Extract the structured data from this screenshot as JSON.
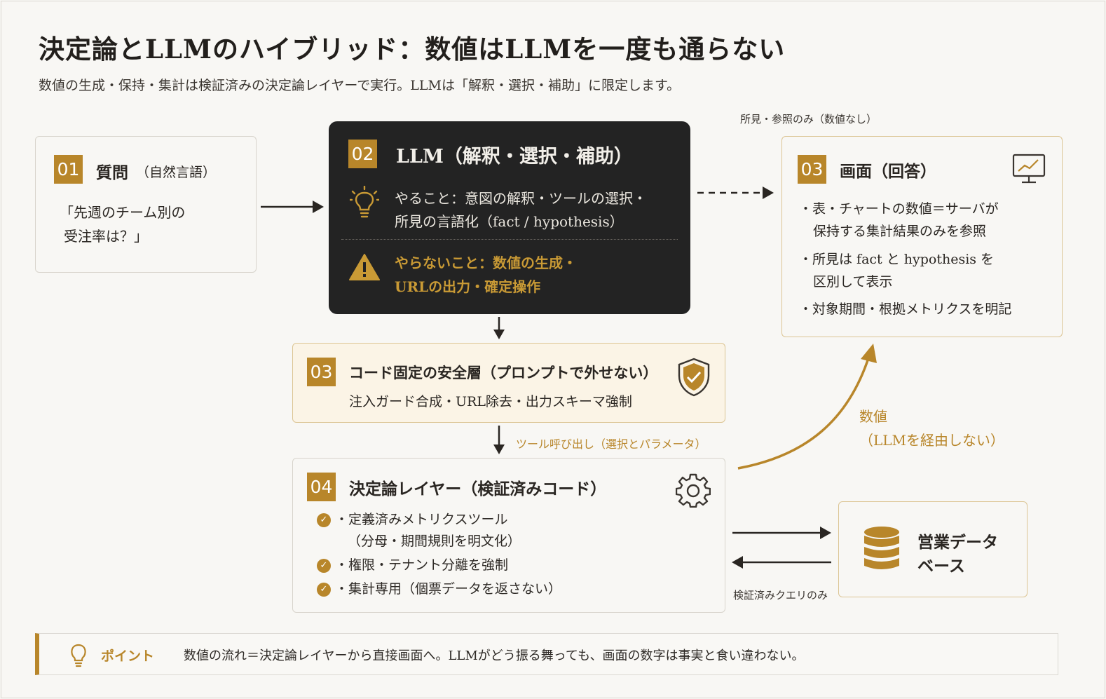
{
  "header": {
    "title": "決定論とLLMのハイブリッド：数値はLLMを一度も通らない",
    "subtitle": "数値の生成・保持・集計は検証済みの決定論レイヤーで実行。LLMは「解釈・選択・補助」に限定します。"
  },
  "question": {
    "num": "01",
    "title": "質問",
    "title_sub": "（自然言語）",
    "line1": "「先週のチーム別の",
    "line2": "受注率は？」"
  },
  "llm": {
    "num": "02",
    "title": "LLM（解釈・選択・補助）",
    "do_line1": "やること：意図の解釈・ツールの選択・",
    "do_line2": "所見の言語化（fact / hypothesis）",
    "dont_line1": "やらないこと：数値の生成・",
    "dont_line2": "URLの出力・確定操作",
    "accent": "#c99a35"
  },
  "screen": {
    "num": "03",
    "title": "画面（回答）",
    "b1_l1": "・表・チャートの数値＝サーバが",
    "b1_l2": "保持する集計結果のみを参照",
    "b2_l1": "・所見は fact と hypothesis を",
    "b2_l2": "区別して表示",
    "b3": "・対象期間・根拠メトリクスを明記"
  },
  "guard": {
    "num": "03",
    "title": "コード固定の安全層（プロンプトで外せない）",
    "desc": "注入ガード合成・URL除去・出力スキーマ強制"
  },
  "layer": {
    "num": "04",
    "title": "決定論レイヤー（検証済みコード）",
    "i1_l1": "・定義済みメトリクスツール",
    "i1_l2": "（分母・期間規則を明文化）",
    "i2": "・権限・テナント分離を強制",
    "i3": "・集計専用（個票データを返さない）"
  },
  "db": {
    "line1": "営業データ",
    "line2": "ベース"
  },
  "labels": {
    "insight_only": "所見・参照のみ（数値なし）",
    "tool_call": "ツール呼び出し（選択とパラメータ）",
    "numbers_l1": "数値",
    "numbers_l2": "（LLMを経由しない）",
    "verified_query": "検証済みクエリのみ"
  },
  "point": {
    "label": "ポイント",
    "text": "数値の流れ＝決定論レイヤーから直接画面へ。LLMがどう振る舞っても、画面の数字は事実と食い違わない。"
  },
  "colors": {
    "gold": "#b8862a",
    "dark_panel": "#232323"
  }
}
